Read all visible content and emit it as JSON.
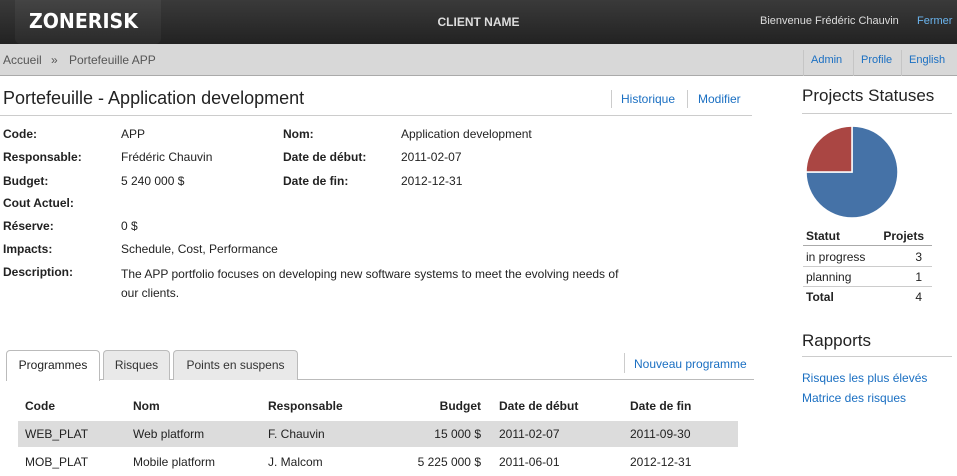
{
  "header": {
    "logo": "ZONERISK",
    "client_name": "CLIENT NAME",
    "welcome": "Bienvenue Frédéric Chauvin",
    "logout": "Fermer"
  },
  "breadcrumb": {
    "home": "Accueil",
    "separator": "»",
    "current": "Portefeuille APP"
  },
  "topnav": [
    "Admin",
    "Profile",
    "English"
  ],
  "page": {
    "title": "Portefeuille - Application development",
    "actions": [
      "Historique",
      "Modifier"
    ]
  },
  "fields": {
    "code": {
      "label": "Code:",
      "value": "APP"
    },
    "responsable": {
      "label": "Responsable:",
      "value": "Frédéric Chauvin"
    },
    "budget": {
      "label": "Budget:",
      "value": "5 240 000 $"
    },
    "cout": {
      "label": "Cout Actuel:",
      "value": ""
    },
    "reserve": {
      "label": "Réserve:",
      "value": "0 $"
    },
    "impacts": {
      "label": "Impacts:",
      "value": "Schedule, Cost, Performance"
    },
    "description": {
      "label": "Description:",
      "value": "The APP portfolio focuses on developing new software systems to meet the evolving needs of our clients."
    },
    "nom": {
      "label": "Nom:",
      "value": "Application development"
    },
    "date_debut": {
      "label": "Date de début:",
      "value": "2011-02-07"
    },
    "date_fin": {
      "label": "Date de fin:",
      "value": "2012-12-31"
    }
  },
  "tabs": [
    "Programmes",
    "Risques",
    "Points en suspens"
  ],
  "new_program": "Nouveau programme",
  "table": {
    "headers": [
      "Code",
      "Nom",
      "Responsable",
      "Budget",
      "Date de début",
      "Date de fin"
    ],
    "rows": [
      [
        "WEB_PLAT",
        "Web platform",
        "F. Chauvin",
        "15 000 $",
        "2011-02-07",
        "2011-09-30"
      ],
      [
        "MOB_PLAT",
        "Mobile platform",
        "J. Malcom",
        "5 225 000 $",
        "2011-06-01",
        "2012-12-31"
      ]
    ]
  },
  "sidebar": {
    "statuses_title": "Projects Statuses",
    "status_headers": [
      "Statut",
      "Projets"
    ],
    "statuses": [
      {
        "name": "in progress",
        "count": "3"
      },
      {
        "name": "planning",
        "count": "1"
      }
    ],
    "total_label": "Total",
    "total_value": "4",
    "reports_title": "Rapports",
    "reports": [
      "Risques les plus élevés",
      "Matrice des risques"
    ]
  },
  "chart_data": {
    "type": "pie",
    "categories": [
      "in progress",
      "planning"
    ],
    "values": [
      3,
      1
    ],
    "colors": [
      "#4572a7",
      "#aa4643"
    ]
  }
}
